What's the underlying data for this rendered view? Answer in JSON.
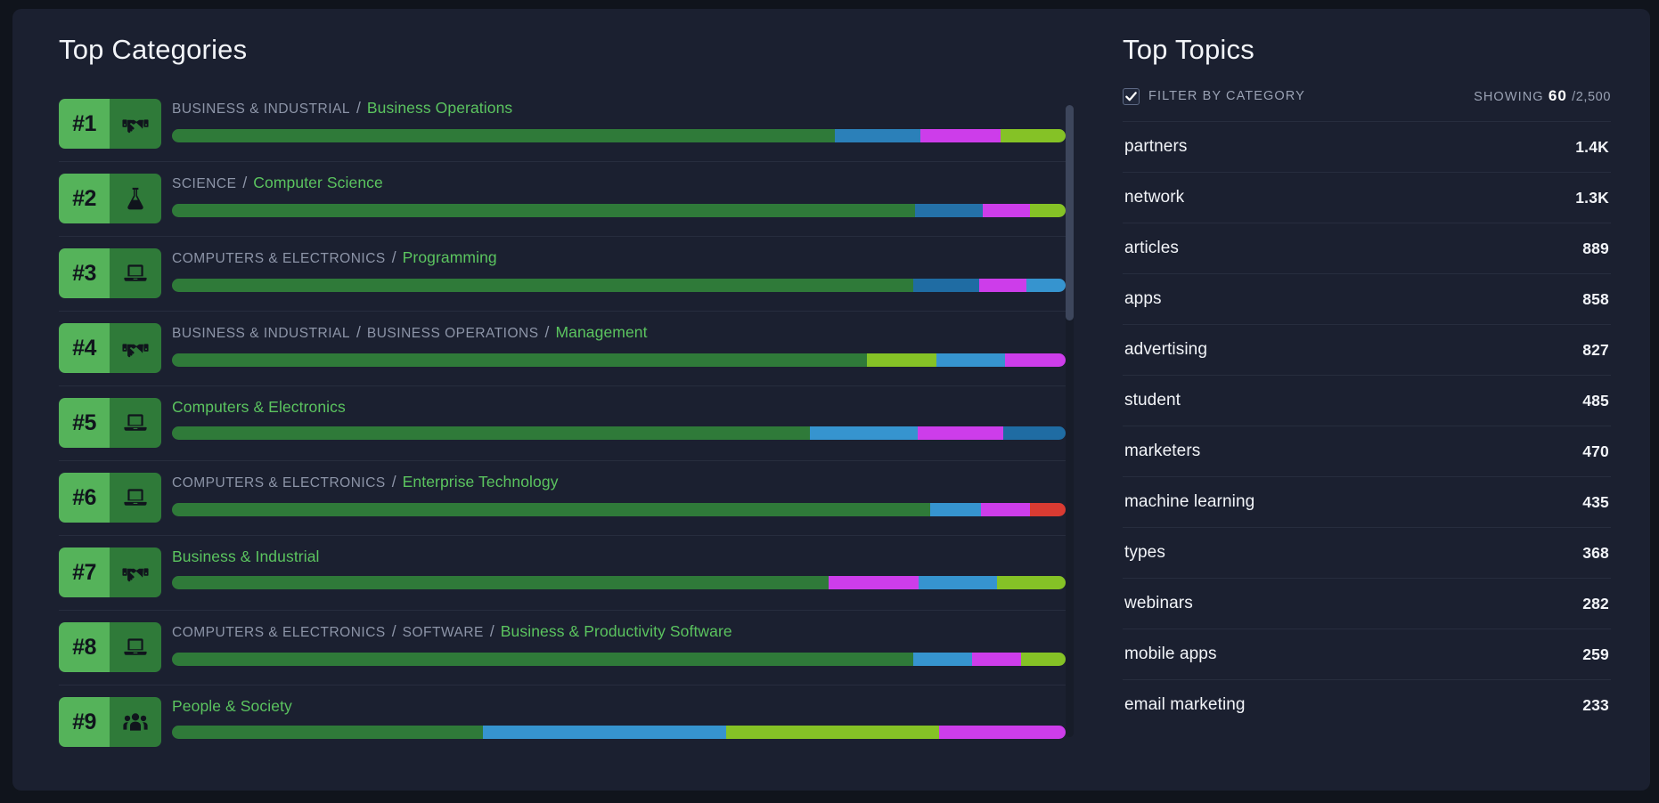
{
  "categories_panel": {
    "title": "Top Categories",
    "items": [
      {
        "rank": "#1",
        "icon": "handshake-icon",
        "crumbs": [
          "BUSINESS & INDUSTRIAL"
        ],
        "leaf": "Business Operations",
        "segments": [
          {
            "color": "#2f7a39",
            "pct": 74.2
          },
          {
            "color": "#2b80b9",
            "pct": 9.5
          },
          {
            "color": "#cd3dea",
            "pct": 9.0
          },
          {
            "color": "#85c226",
            "pct": 7.3
          }
        ]
      },
      {
        "rank": "#2",
        "icon": "flask-icon",
        "crumbs": [
          "SCIENCE"
        ],
        "leaf": "Computer Science",
        "segments": [
          {
            "color": "#2f7a39",
            "pct": 83.2
          },
          {
            "color": "#2471a8",
            "pct": 7.5
          },
          {
            "color": "#cd3dea",
            "pct": 5.3
          },
          {
            "color": "#85c226",
            "pct": 4.0
          }
        ]
      },
      {
        "rank": "#3",
        "icon": "laptop-icon",
        "crumbs": [
          "COMPUTERS & ELECTRONICS"
        ],
        "leaf": "Programming",
        "segments": [
          {
            "color": "#2f7a39",
            "pct": 83.0
          },
          {
            "color": "#1f6ca3",
            "pct": 7.3
          },
          {
            "color": "#cd3dea",
            "pct": 5.3
          },
          {
            "color": "#3694cf",
            "pct": 4.4
          }
        ]
      },
      {
        "rank": "#4",
        "icon": "handshake-icon",
        "crumbs": [
          "BUSINESS & INDUSTRIAL",
          "BUSINESS OPERATIONS"
        ],
        "leaf": "Management",
        "segments": [
          {
            "color": "#2f7a39",
            "pct": 77.8
          },
          {
            "color": "#85c226",
            "pct": 7.7
          },
          {
            "color": "#3694cf",
            "pct": 7.7
          },
          {
            "color": "#cd3dea",
            "pct": 6.8
          }
        ]
      },
      {
        "rank": "#5",
        "icon": "laptop-icon",
        "crumbs": [],
        "leaf": "Computers & Electronics",
        "segments": [
          {
            "color": "#2f7a39",
            "pct": 71.4
          },
          {
            "color": "#3694cf",
            "pct": 12.0
          },
          {
            "color": "#cd3dea",
            "pct": 9.6
          },
          {
            "color": "#1f6ca3",
            "pct": 7.0
          }
        ]
      },
      {
        "rank": "#6",
        "icon": "laptop-icon",
        "crumbs": [
          "COMPUTERS & ELECTRONICS"
        ],
        "leaf": "Enterprise Technology",
        "segments": [
          {
            "color": "#2f7a39",
            "pct": 84.8
          },
          {
            "color": "#3694cf",
            "pct": 5.7
          },
          {
            "color": "#cd3dea",
            "pct": 5.5
          },
          {
            "color": "#d93b32",
            "pct": 4.0
          }
        ]
      },
      {
        "rank": "#7",
        "icon": "handshake-icon",
        "crumbs": [],
        "leaf": "Business & Industrial",
        "segments": [
          {
            "color": "#2f7a39",
            "pct": 73.5
          },
          {
            "color": "#cd3dea",
            "pct": 10.0
          },
          {
            "color": "#3694cf",
            "pct": 8.8
          },
          {
            "color": "#85c226",
            "pct": 7.7
          }
        ]
      },
      {
        "rank": "#8",
        "icon": "laptop-icon",
        "crumbs": [
          "COMPUTERS & ELECTRONICS",
          "SOFTWARE"
        ],
        "leaf": "Business & Productivity Software",
        "segments": [
          {
            "color": "#2f7a39",
            "pct": 83.0
          },
          {
            "color": "#3694cf",
            "pct": 6.5
          },
          {
            "color": "#cd3dea",
            "pct": 5.5
          },
          {
            "color": "#85c226",
            "pct": 5.0
          }
        ]
      },
      {
        "rank": "#9",
        "icon": "people-icon",
        "crumbs": [],
        "leaf": "People & Society",
        "segments": [
          {
            "color": "#2f7a39",
            "pct": 34.8
          },
          {
            "color": "#3694cf",
            "pct": 27.2
          },
          {
            "color": "#85c226",
            "pct": 23.8
          },
          {
            "color": "#cd3dea",
            "pct": 14.2
          }
        ]
      }
    ]
  },
  "topics_panel": {
    "title": "Top Topics",
    "filter_label": "FILTER BY CATEGORY",
    "filter_checked": true,
    "showing_label": "SHOWING",
    "showing_count": "60",
    "showing_total": "/2,500",
    "items": [
      {
        "name": "partners",
        "count": "1.4K"
      },
      {
        "name": "network",
        "count": "1.3K"
      },
      {
        "name": "articles",
        "count": "889"
      },
      {
        "name": "apps",
        "count": "858"
      },
      {
        "name": "advertising",
        "count": "827"
      },
      {
        "name": "student",
        "count": "485"
      },
      {
        "name": "marketers",
        "count": "470"
      },
      {
        "name": "machine learning",
        "count": "435"
      },
      {
        "name": "types",
        "count": "368"
      },
      {
        "name": "webinars",
        "count": "282"
      },
      {
        "name": "mobile apps",
        "count": "259"
      },
      {
        "name": "email marketing",
        "count": "233"
      }
    ]
  },
  "colors": {
    "panel_bg": "#1b2030",
    "page_bg": "#10141c",
    "accent_green": "#5bc45f",
    "badge_rank_bg": "#55b35a",
    "badge_icon_bg": "#2f7a39",
    "divider": "#272d3e",
    "muted_text": "#8d95a8"
  }
}
